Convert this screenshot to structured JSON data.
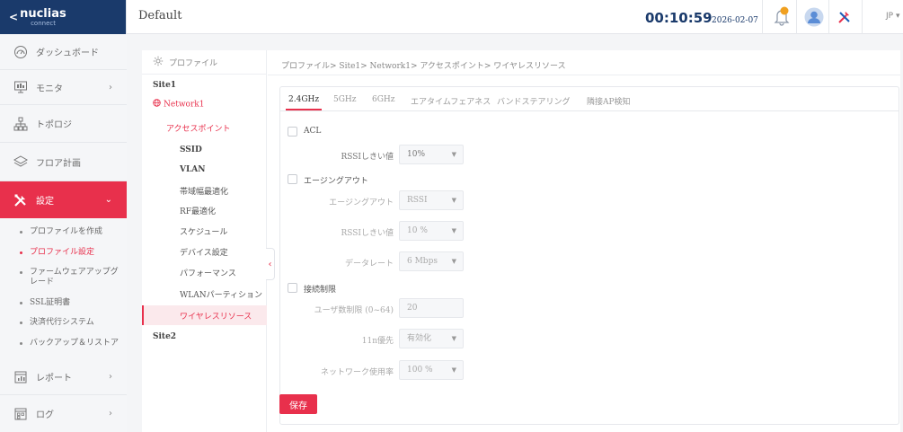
{
  "logo": {
    "chevron": "<",
    "main": "nuclias",
    "sub": "connect"
  },
  "header": {
    "title": "Default",
    "time": "00:10:59",
    "date": "2026-02-07",
    "lang": "JP ▾"
  },
  "sidebar": {
    "items": [
      {
        "label": "ダッシュボード",
        "icon": "dashboard-icon"
      },
      {
        "label": "モニタ",
        "icon": "monitor-icon",
        "arrow": "›"
      },
      {
        "label": "トポロジ",
        "icon": "topology-icon"
      },
      {
        "label": "フロア計画",
        "icon": "floor-plan-icon"
      },
      {
        "label": "設定",
        "icon": "settings-tools-icon",
        "arrow": "⌄"
      },
      {
        "label": "レポート",
        "icon": "report-icon",
        "arrow": "›"
      },
      {
        "label": "ログ",
        "icon": "log-icon",
        "arrow": "›"
      }
    ],
    "sub": [
      {
        "label": "プロファイルを作成"
      },
      {
        "label": "プロファイル設定"
      },
      {
        "label": "ファームウェアアップグ",
        "label2": "レード"
      },
      {
        "label": "SSL証明書"
      },
      {
        "label": "決済代行システム"
      },
      {
        "label": "バックアップ＆リストア"
      }
    ]
  },
  "profile_panel": {
    "heading": "プロファイル",
    "site1": "Site1",
    "network": "Network1",
    "access_point": "アクセスポイント",
    "children": [
      "SSID",
      "VLAN",
      "帯域幅最適化",
      "RF最適化",
      "スケジュール",
      "デバイス設定",
      "パフォーマンス",
      "WLANパーティション",
      "ワイヤレスリソース"
    ],
    "site2": "Site2"
  },
  "breadcrumb": "プロファイル> Site1> Network1> アクセスポイント> ワイヤレスリソース",
  "tabs": [
    "2.4GHz",
    "5GHz",
    "6GHz",
    "エアタイムフェアネス",
    "バンドステアリング",
    "隣接AP検知"
  ],
  "form": {
    "acl": {
      "label": "ACL",
      "rssi_label": "RSSIしきい値",
      "rssi_value": "10%"
    },
    "aging": {
      "label": "エージングアウト",
      "aging_label": "エージングアウト",
      "aging_value": "RSSI",
      "rssi_label": "RSSIしきい値",
      "rssi_value": "10 %",
      "rate_label": "データレート",
      "rate_value": "6 Mbps"
    },
    "conn": {
      "label": "接続制限",
      "user_label": "ユーザ数制限 (0~64)",
      "user_value": "20",
      "pref_label": "11n優先",
      "pref_value": "有効化",
      "usage_label": "ネットワーク使用率",
      "usage_value": "100 %"
    },
    "save": "保存"
  },
  "colors": {
    "accent": "#e8304c",
    "brand": "#1a3a6b"
  }
}
